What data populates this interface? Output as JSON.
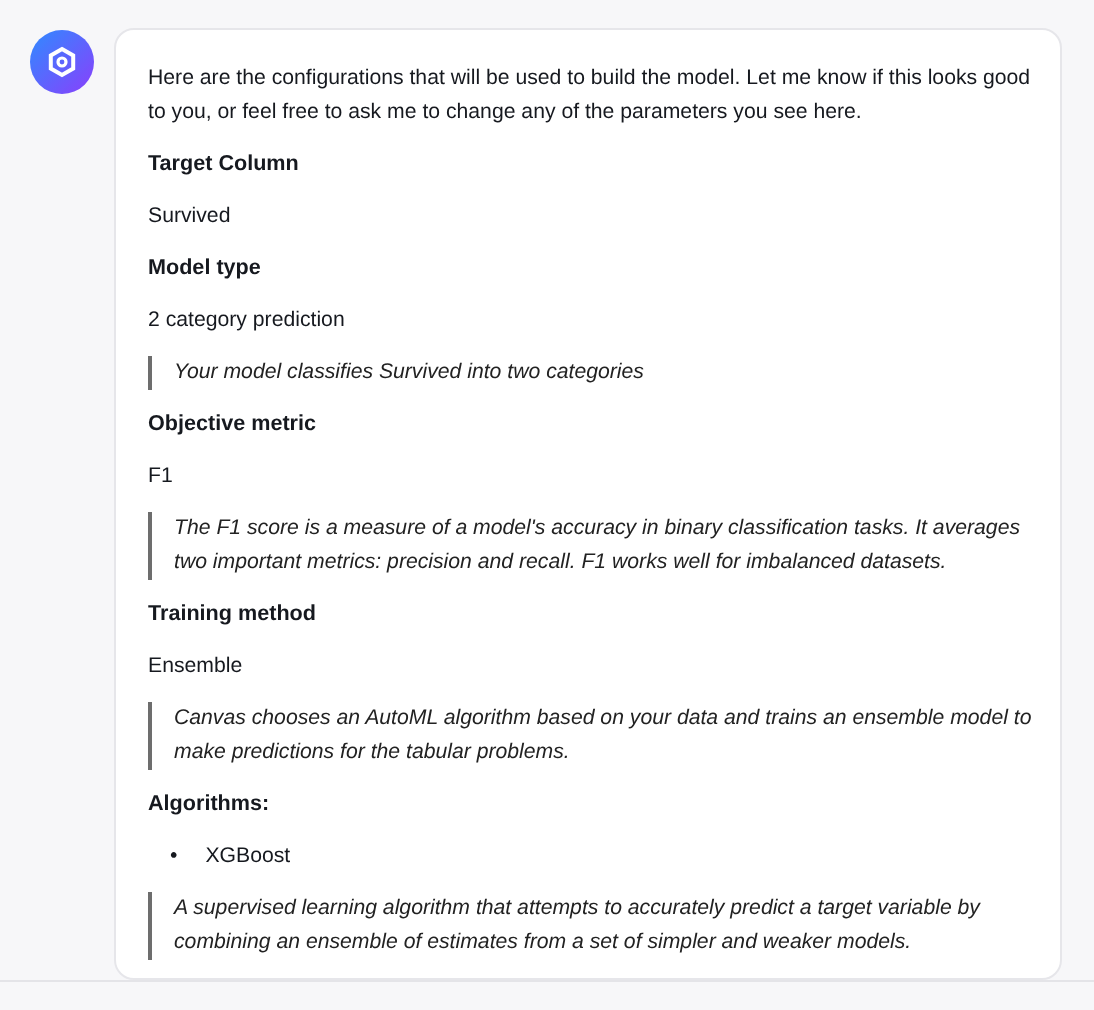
{
  "message": {
    "intro": "Here are the configurations that will be used to build the model. Let me know if this looks good to you, or feel free to ask me to change any of the parameters you see here.",
    "sections": [
      {
        "heading": "Target Column",
        "value": "Survived"
      },
      {
        "heading": "Model type",
        "value": "2 category prediction",
        "note": "Your model classifies Survived into two categories"
      },
      {
        "heading": "Objective metric",
        "value": "F1",
        "note": "The F1 score is a measure of a model's accuracy in binary classification tasks. It averages two important metrics: precision and recall. F1 works well for imbalanced datasets."
      },
      {
        "heading": "Training method",
        "value": "Ensemble",
        "note": "Canvas chooses an AutoML algorithm based on your data and trains an ensemble model to make predictions for the tabular problems."
      },
      {
        "heading": "Algorithms:",
        "items": [
          {
            "bullet": "•",
            "name": "XGBoost",
            "note": "A supervised learning algorithm that attempts to accurately predict a target variable by combining an ensemble of estimates from a set of simpler and weaker models."
          }
        ]
      }
    ]
  }
}
